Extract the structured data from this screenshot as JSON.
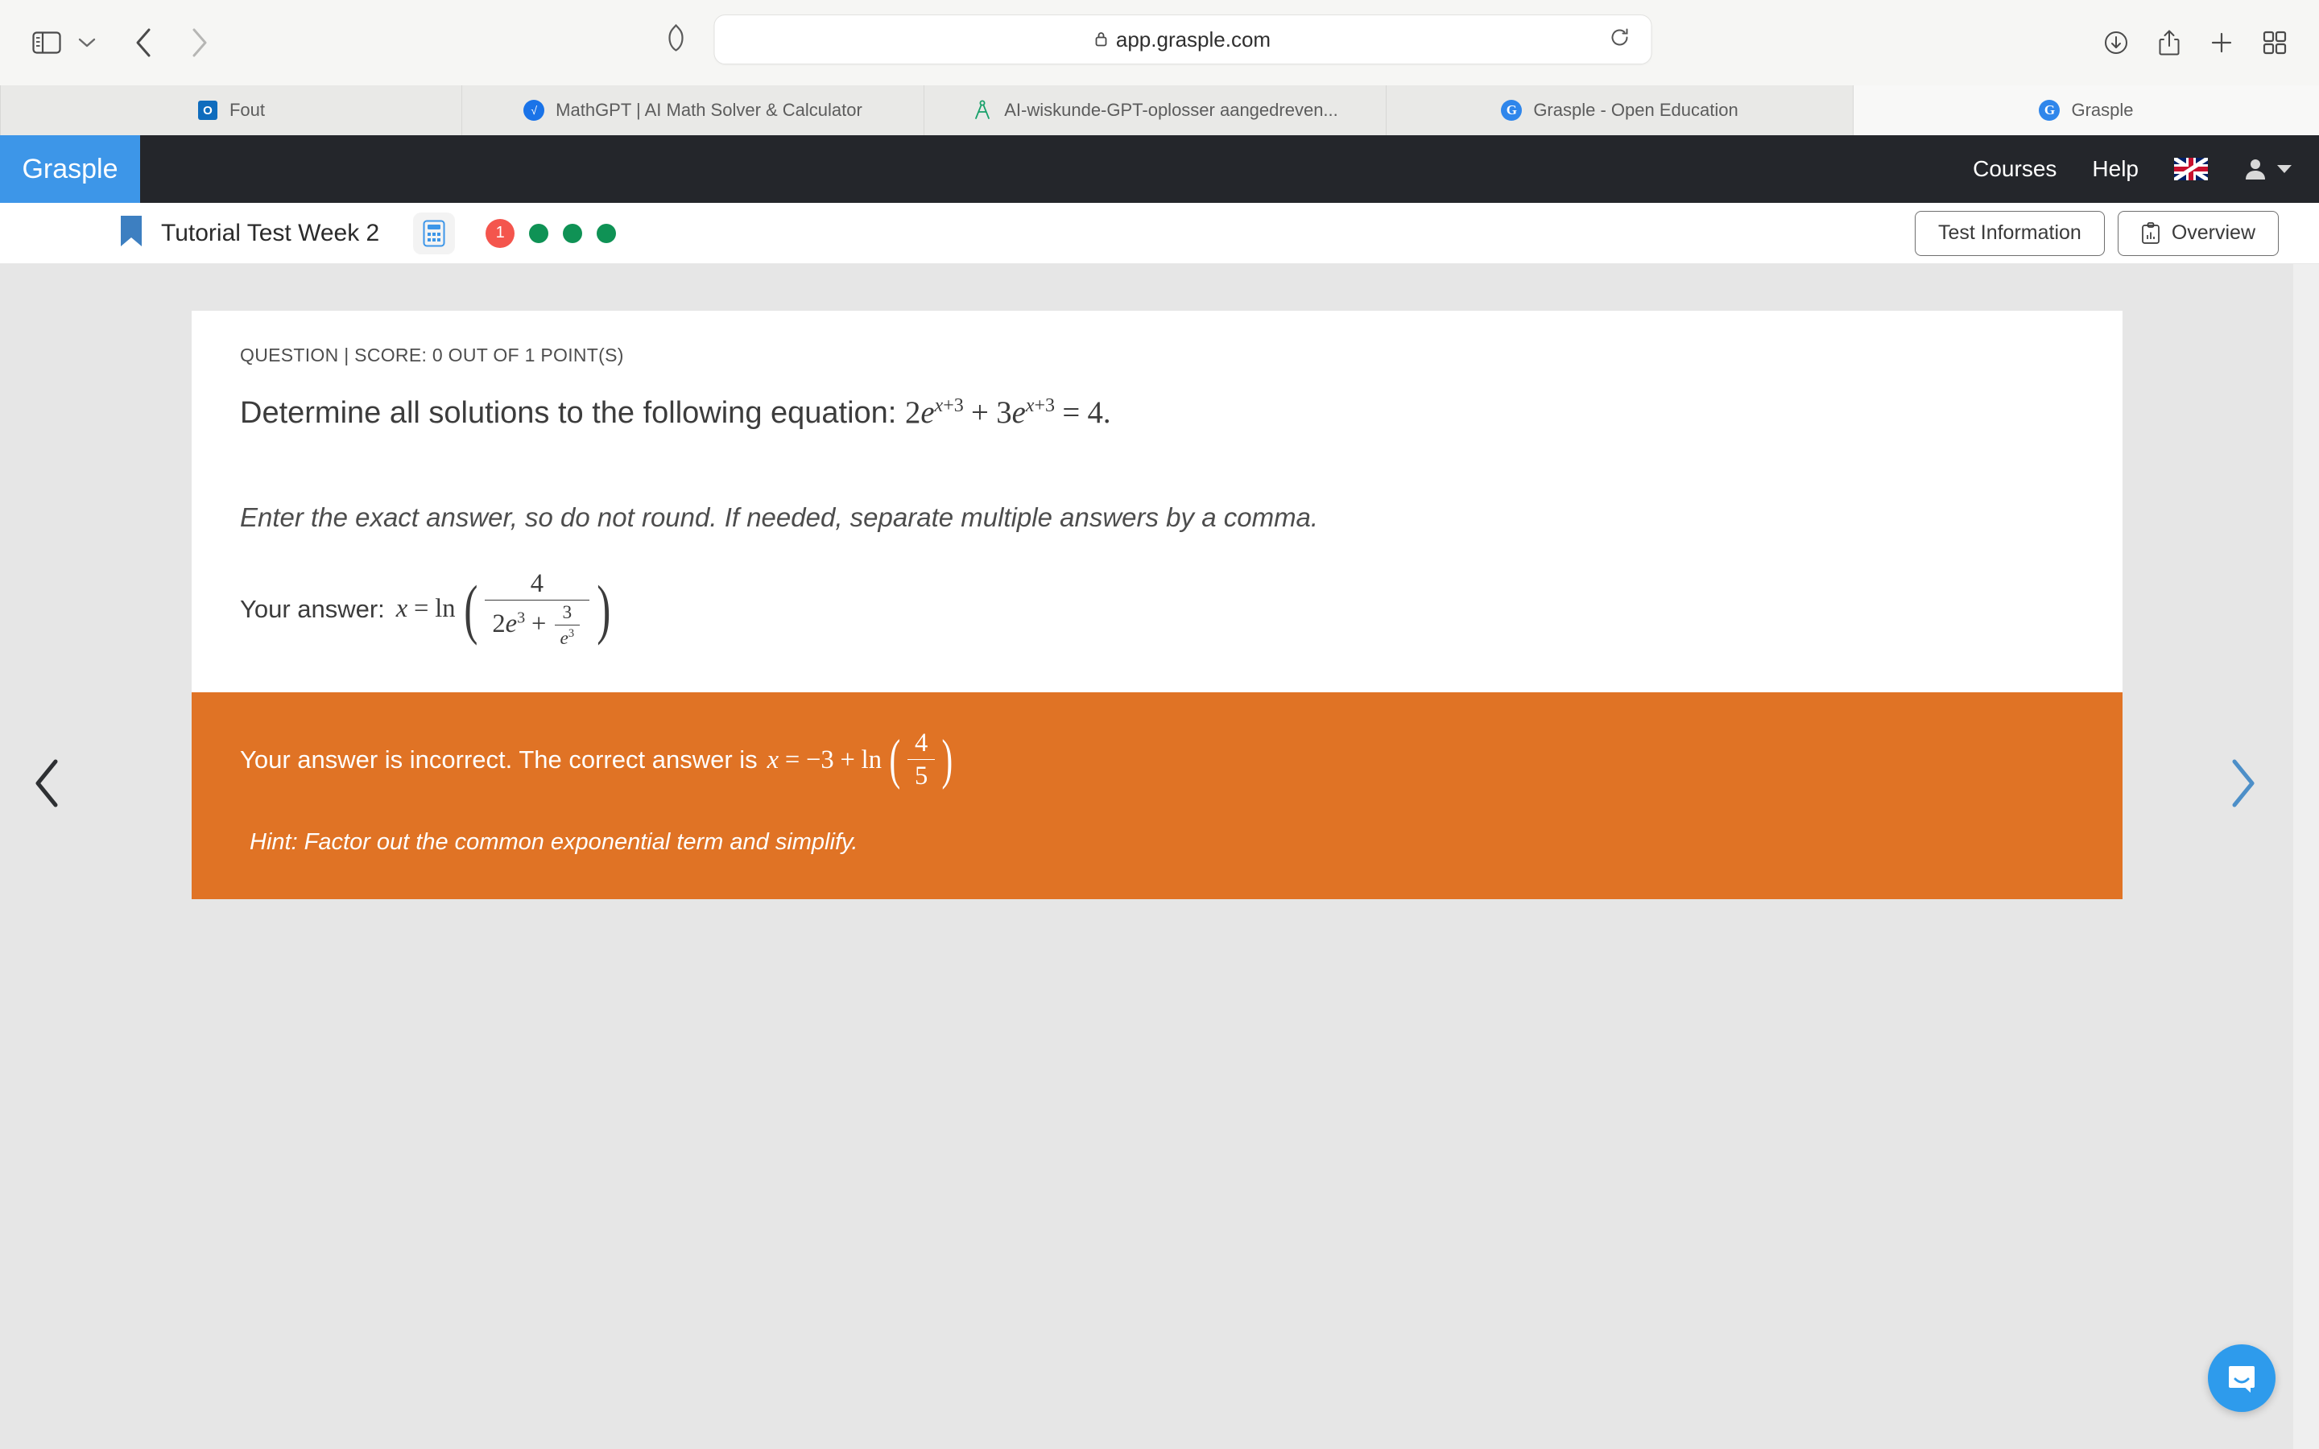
{
  "browser": {
    "url": "app.grasple.com",
    "lock_icon": "lock-icon",
    "sidebar_icon": "sidebar-toggle-icon",
    "back_icon": "chevron-left-icon",
    "forward_icon": "chevron-right-icon",
    "shield_icon": "shield-icon",
    "reload_icon": "reload-icon",
    "download_icon": "download-icon",
    "share_icon": "share-icon",
    "newtab_icon": "plus-icon",
    "tabgrid_icon": "tab-overview-icon",
    "tabs": [
      {
        "label": "Fout",
        "favicon": "outlook-icon",
        "active": false
      },
      {
        "label": "MathGPT | AI Math Solver & Calculator",
        "favicon": "mathgpt-icon",
        "active": false
      },
      {
        "label": "AI-wiskunde-GPT-oplosser aangedreven...",
        "favicon": "compass-icon",
        "active": false
      },
      {
        "label": "Grasple - Open Education",
        "favicon": "grasple-icon",
        "active": false
      },
      {
        "label": "Grasple",
        "favicon": "grasple-icon",
        "active": true
      }
    ]
  },
  "app_nav": {
    "brand": "Grasple",
    "brand_bg": "#3d96e8",
    "links": [
      "Courses",
      "Help"
    ],
    "language_flag": "uk-flag-icon",
    "user_icon": "user-avatar-icon",
    "user_caret": "caret-down-icon"
  },
  "toolbar": {
    "bookmark_icon": "bookmark-icon",
    "title": "Tutorial Test Week 2",
    "calculator_icon": "calculator-icon",
    "progress": {
      "current_label": "1",
      "current_color": "#f4554d",
      "completed_color": "#0f9255",
      "completed_count": 3
    },
    "test_information_label": "Test Information",
    "overview_label": "Overview",
    "overview_icon": "clipboard-chart-icon"
  },
  "question": {
    "meta": "QUESTION | SCORE: 0 OUT OF 1 POINT(S)",
    "prompt_prefix": "Determine all solutions to the following equation:",
    "equation": {
      "lhs_term1_coef": "2",
      "lhs_base": "e",
      "lhs_exp": "x+3",
      "operator": "+",
      "lhs_term2_coef": "3",
      "equals": "=",
      "rhs": "4",
      "period": "."
    },
    "instruction": "Enter the exact answer, so do not round. If needed, separate multiple answers by a comma.",
    "answer_label": "Your answer:",
    "answer": {
      "variable": "x",
      "equals": "=",
      "fn": "ln",
      "numerator": "4",
      "den_coef": "2",
      "den_base": "e",
      "den_exp": "3",
      "den_plus": "+",
      "den_frac_num": "3",
      "den_frac_den_base": "e",
      "den_frac_den_exp": "3"
    }
  },
  "feedback": {
    "bg_color": "#e07325",
    "message": "Your answer is incorrect. The correct answer is",
    "correct_answer": {
      "variable": "x",
      "equals": "=",
      "constant": "−3",
      "plus": "+",
      "fn": "ln",
      "frac_num": "4",
      "frac_den": "5"
    },
    "hint": "Hint: Factor out the common exponential term and simplify."
  },
  "navigation": {
    "prev_icon": "chevron-left-icon",
    "next_icon": "chevron-right-icon",
    "next_color": "#4d8fc8"
  },
  "support": {
    "chat_icon": "chat-bubble-icon",
    "chat_color": "#2e9bec"
  }
}
